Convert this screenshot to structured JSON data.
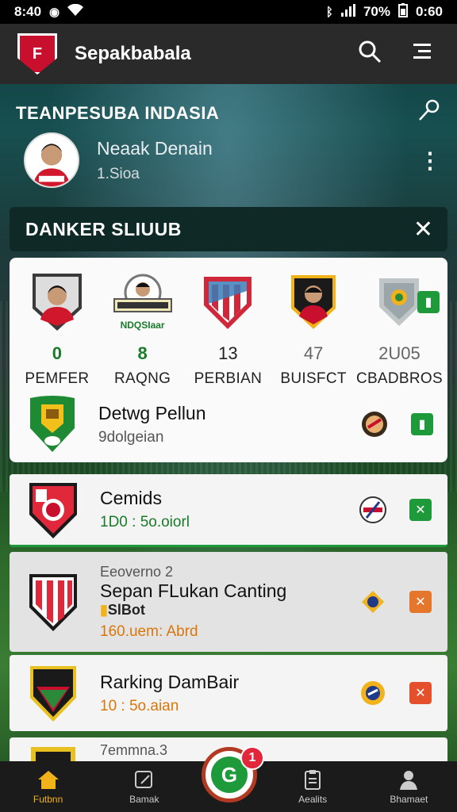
{
  "status_bar": {
    "time": "8:40",
    "battery_pct": "70%",
    "clock_right": "0:60"
  },
  "app_bar": {
    "logo_text": "F",
    "title": "Sepakbabala",
    "search_icon": "search-icon",
    "menu_icon": "menu-icon"
  },
  "team": {
    "title": "TEANPESUBA INDASIA",
    "player_name": "Neaak Denain",
    "player_sub": "1.Sioa"
  },
  "banner": {
    "title": "DANKER SLIUUB",
    "close_icon": "close-icon"
  },
  "ranking": {
    "columns": [
      {
        "badge": "player",
        "value": "0",
        "label": "PEMFER",
        "style": "green"
      },
      {
        "badge": "crest",
        "caption": "NDQSIaar",
        "value": "8",
        "label": "RAQNG",
        "style": "green"
      },
      {
        "badge": "shield",
        "value": "13",
        "label": "PERBIAN",
        "style": "normal"
      },
      {
        "badge": "player-shield",
        "value": "47",
        "label": "BUISFCT",
        "style": "grey"
      },
      {
        "badge": "grey-shield",
        "value": "2U05",
        "label": "CBADBROS",
        "style": "grey"
      }
    ],
    "top_action_icon": "briefcase-icon",
    "item": {
      "name": "Detwg Pellun",
      "sub": "9dolgeian",
      "action_icon": "briefcase-icon"
    }
  },
  "list": [
    {
      "kicker": "",
      "name": "Cemids",
      "sub": "1D0 : 5o.oiorl",
      "sub_color": "green",
      "action_color": "#1f9a3a",
      "action_glyph": "✕",
      "grey": false
    },
    {
      "kicker": "Eeoverno 2",
      "name": "Sepan FLukan Canting",
      "tag": "SlBot",
      "sub": "160.uem: Abrd",
      "sub_color": "orange",
      "action_color": "#e5772c",
      "action_glyph": "✕",
      "grey": true
    },
    {
      "kicker": "",
      "name": "Rarking DamBair",
      "sub": "10 : 5o.aian",
      "sub_color": "orange",
      "action_color": "#e5502c",
      "action_glyph": "✕",
      "grey": false
    },
    {
      "kicker": "7emmna.3",
      "name": "",
      "sub": "",
      "sub_color": "orange",
      "grey": false
    }
  ],
  "bottom_nav": {
    "items": [
      {
        "label": "Futbnn",
        "icon": "home-icon"
      },
      {
        "label": "Bamak",
        "icon": "edit-icon"
      },
      {
        "label": "Aealits",
        "icon": "clipboard-icon"
      },
      {
        "label": "Bhamaet",
        "icon": "profile-icon"
      }
    ],
    "fab_badge": "1",
    "fab_glyph": "G"
  },
  "colors": {
    "accent_green": "#1f9a3a",
    "brand_red": "#c8102e",
    "nav_active": "#f2b21a"
  }
}
